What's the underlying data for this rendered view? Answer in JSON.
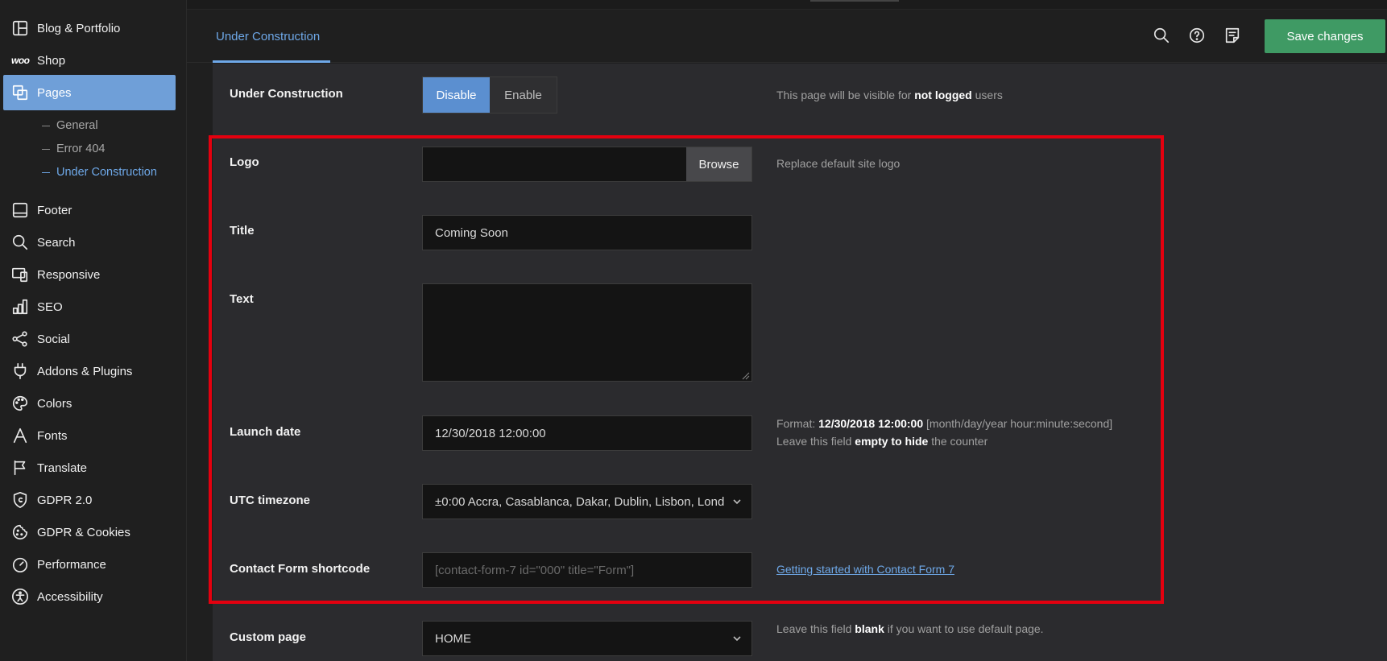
{
  "sidebar": {
    "items": [
      {
        "label": "Blog & Portfolio",
        "icon": "layout-icon"
      },
      {
        "label": "Shop",
        "icon": "woo-icon",
        "icon_text": "woo"
      },
      {
        "label": "Pages",
        "icon": "pages-icon",
        "active": true
      },
      {
        "label": "Footer",
        "icon": "footer-icon"
      },
      {
        "label": "Search",
        "icon": "search-icon"
      },
      {
        "label": "Responsive",
        "icon": "responsive-icon"
      },
      {
        "label": "SEO",
        "icon": "bar-chart-icon"
      },
      {
        "label": "Social",
        "icon": "share-icon"
      },
      {
        "label": "Addons & Plugins",
        "icon": "plug-icon"
      },
      {
        "label": "Colors",
        "icon": "palette-icon"
      },
      {
        "label": "Fonts",
        "icon": "font-icon"
      },
      {
        "label": "Translate",
        "icon": "flag-icon"
      },
      {
        "label": "GDPR 2.0",
        "icon": "shield-icon"
      },
      {
        "label": "GDPR & Cookies",
        "icon": "cookie-icon"
      },
      {
        "label": "Performance",
        "icon": "gauge-icon"
      },
      {
        "label": "Accessibility",
        "icon": "accessibility-icon"
      }
    ],
    "subitems": [
      {
        "label": "General"
      },
      {
        "label": "Error 404"
      },
      {
        "label": "Under Construction",
        "current": true
      }
    ]
  },
  "header": {
    "tab": "Under Construction",
    "save_label": "Save changes",
    "icons": [
      "search-icon",
      "help-icon",
      "notes-icon"
    ]
  },
  "form": {
    "under_construction": {
      "label": "Under Construction",
      "options": [
        "Disable",
        "Enable"
      ],
      "selected": "Disable",
      "help_prefix": "This page will be visible for ",
      "help_bold": "not logged",
      "help_suffix": " users"
    },
    "logo": {
      "label": "Logo",
      "value": "",
      "browse_label": "Browse",
      "help": "Replace default site logo"
    },
    "title": {
      "label": "Title",
      "value": "Coming Soon"
    },
    "text": {
      "label": "Text",
      "value": ""
    },
    "launch_date": {
      "label": "Launch date",
      "value": "12/30/2018 12:00:00",
      "help_format_prefix": "Format: ",
      "help_format_bold": "12/30/2018 12:00:00",
      "help_format_suffix": " [month/day/year hour:minute:second]",
      "help_empty_prefix": "Leave this field ",
      "help_empty_bold": "empty to hide",
      "help_empty_suffix": " the counter"
    },
    "utc_timezone": {
      "label": "UTC timezone",
      "value": "±0:00 Accra, Casablanca, Dakar, Dublin, Lisbon, Lond"
    },
    "contact_form": {
      "label": "Contact Form shortcode",
      "placeholder": "[contact-form-7 id=\"000\" title=\"Form\"]",
      "help_link": "Getting started with Contact Form 7"
    },
    "custom_page": {
      "label": "Custom page",
      "value": "HOME",
      "help_prefix": "Leave this field ",
      "help_bold": "blank",
      "help_suffix": " if you want to use default page."
    }
  },
  "colors": {
    "accent": "#6ea8e8",
    "active_nav": "#6f9fd8",
    "save": "#3f9a64",
    "highlight": "#e4000f"
  }
}
